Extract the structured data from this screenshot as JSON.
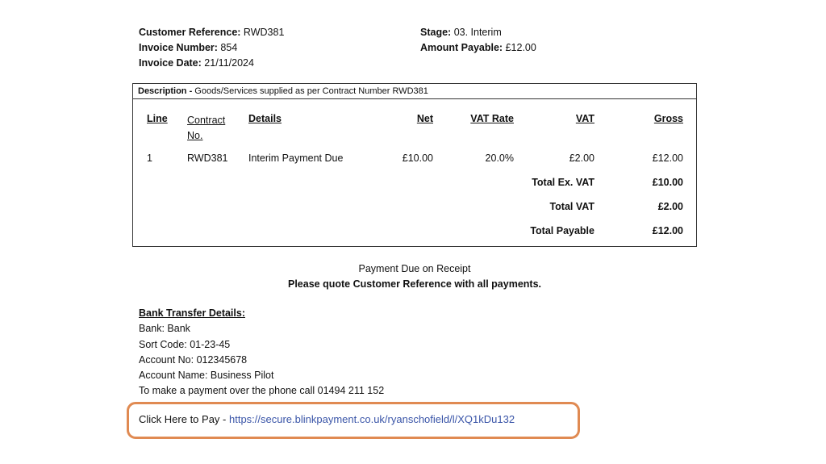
{
  "header": {
    "customer_reference_label": "Customer Reference:",
    "customer_reference": "RWD381",
    "invoice_number_label": "Invoice Number:",
    "invoice_number": "854",
    "invoice_date_label": "Invoice Date:",
    "invoice_date": "21/11/2024",
    "stage_label": "Stage:",
    "stage": "03. Interim",
    "amount_payable_label": "Amount Payable:",
    "amount_payable": "£12.00"
  },
  "table": {
    "description_label": "Description -",
    "description_text": "Goods/Services supplied as per Contract Number RWD381",
    "columns": {
      "line": "Line",
      "contract_line1": "Contract",
      "contract_line2": "No.",
      "details": "Details",
      "net": "Net",
      "vat_rate": "VAT Rate",
      "vat": "VAT",
      "gross": "Gross"
    },
    "rows": [
      {
        "line": "1",
        "contract": "RWD381",
        "details": "Interim Payment Due",
        "net": "£10.00",
        "vat_rate": "20.0%",
        "vat": "£2.00",
        "gross": "£12.00"
      }
    ],
    "totals": [
      {
        "label": "Total Ex. VAT",
        "value": "£10.00"
      },
      {
        "label": "Total VAT",
        "value": "£2.00"
      },
      {
        "label": "Total Payable",
        "value": "£12.00"
      }
    ]
  },
  "notes": {
    "payment_due": "Payment Due on Receipt",
    "quote_reference": "Please quote Customer Reference with all payments."
  },
  "bank": {
    "heading": "Bank Transfer Details:",
    "bank": "Bank: Bank",
    "sort_code": "Sort Code: 01-23-45",
    "account_no": "Account No: 012345678",
    "account_name": "Account Name: Business Pilot",
    "phone": "To make a payment over the phone call 01494 211 152"
  },
  "pay": {
    "label": "Click Here to Pay -",
    "link": "https://secure.blinkpayment.co.uk/ryanschofield/l/XQ1kDu132"
  },
  "colors": {
    "highlight_border": "#e08a52",
    "link": "#3a55a8"
  }
}
